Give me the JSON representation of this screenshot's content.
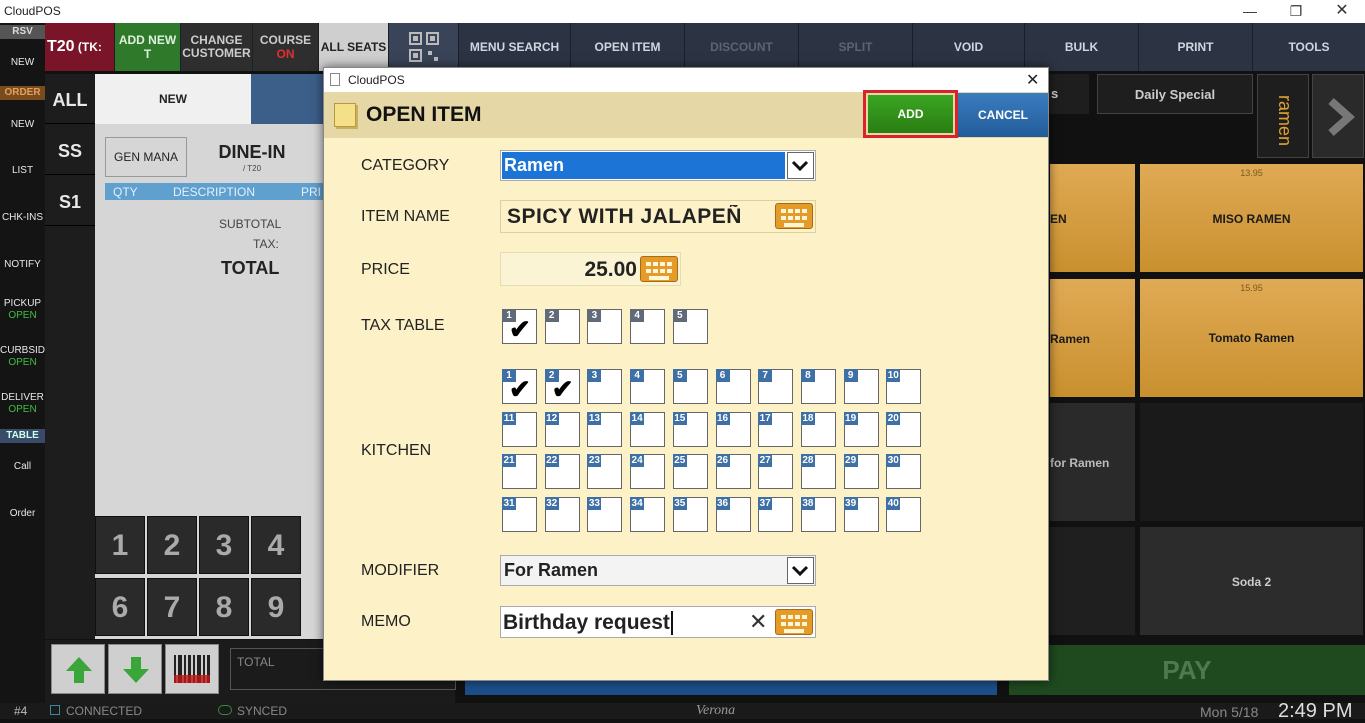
{
  "window": {
    "title": "CloudPOS"
  },
  "leftnav": {
    "rsv": "RSV",
    "rsv_new": "NEW",
    "order": "ORDER",
    "order_new": "NEW",
    "list": "LIST",
    "chkins": "CHK-INS",
    "notify": "NOTIFY",
    "pickup": "PICKUP",
    "pickup_status": "OPEN",
    "curbside": "CURBSID",
    "curbside_status": "OPEN",
    "delivery": "DELIVER",
    "delivery_status": "OPEN",
    "table": "TABLE",
    "call": "Call",
    "order_btn": "Order"
  },
  "topbar": {
    "ticket": "T20",
    "ticket_suffix": "(TK:",
    "add_new": "ADD NEW T",
    "change_customer": "CHANGE CUSTOMER",
    "course": "COURSE",
    "course_status": "ON",
    "all_seats": "ALL SEATS",
    "menu_search": "MENU SEARCH",
    "open_item": "OPEN ITEM",
    "discount": "DISCOUNT",
    "split": "SPLIT",
    "void": "VOID",
    "bulk": "BULK",
    "print": "PRINT",
    "tools": "TOOLS"
  },
  "order": {
    "seats": [
      "ALL",
      "SS",
      "S1"
    ],
    "tab_new": "NEW",
    "gen_mana": "GEN MANA",
    "dine_in": "DINE-IN",
    "dine_in_sub": "/ T20",
    "col_qty": "QTY",
    "col_desc": "DESCRIPTION",
    "col_price": "PRI",
    "subtotal": "SUBTOTAL",
    "tax": "TAX:",
    "total": "TOTAL",
    "numpad": [
      "1",
      "2",
      "3",
      "4",
      "6",
      "7",
      "8",
      "9"
    ],
    "total_box": "TOTAL"
  },
  "menu": {
    "tabs": [
      "s",
      "Daily Special"
    ],
    "side_tab": "ramen",
    "tiles": [
      {
        "name": "EN",
        "price": ""
      },
      {
        "name": "MISO RAMEN",
        "price": "13.95"
      },
      {
        "name": "Ramen",
        "price": ""
      },
      {
        "name": "Tomato Ramen",
        "price": "15.95"
      },
      {
        "name": "for Ramen",
        "price": ""
      },
      {
        "name": "Soda 2",
        "price": ""
      }
    ],
    "pay": "PAY"
  },
  "status": {
    "station": "#4",
    "connected": "CONNECTED",
    "synced": "SYNCED",
    "brand": "Verona",
    "date": "Mon 5/18",
    "time": "2:49 PM"
  },
  "dialog": {
    "window_title": "CloudPOS",
    "title": "OPEN ITEM",
    "add_label": "ADD",
    "cancel_label": "CANCEL",
    "category_label": "CATEGORY",
    "category_value": "Ramen",
    "item_name_label": "ITEM NAME",
    "item_name_value": "SPICY WITH JALAPEÑ",
    "price_label": "PRICE",
    "price_value": "25.00",
    "tax_label": "TAX TABLE",
    "tax_checked": [
      1
    ],
    "kitchen_label": "KITCHEN",
    "kitchen_checked": [
      1,
      2
    ],
    "modifier_label": "MODIFIER",
    "modifier_value": "For Ramen",
    "memo_label": "MEMO",
    "memo_value": "Birthday request",
    "colors": {
      "add": "#2f8f1a",
      "cancel": "#2a6aa6",
      "highlight": "#d9232a",
      "category_selected": "#1b74d6"
    }
  }
}
